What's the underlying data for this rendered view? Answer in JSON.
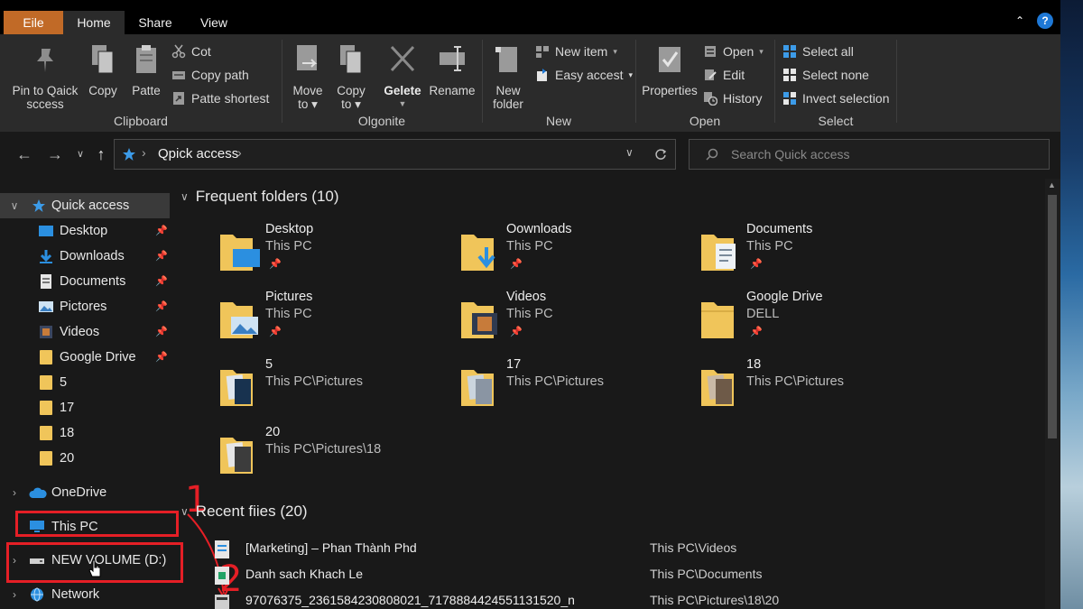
{
  "tabs": {
    "file": "Eile",
    "home": "Home",
    "share": "Share",
    "view": "View",
    "help": "?"
  },
  "ribbon": {
    "clipboard": {
      "pin": "Pin to Qaick\nsccess",
      "copy": "Copy",
      "paste": "Patte",
      "cut": "Cot",
      "copy_path": "Copy path",
      "paste_shortcut": "Patte shortest",
      "label": "Clipboard"
    },
    "organize": {
      "move_to": "Move\nto ▾",
      "copy_to": "Copy\nto ▾",
      "delete": "Gelete",
      "rename": "Rename",
      "label": "Olgonite"
    },
    "new": {
      "new_folder": "New\nfolder",
      "new_item": "New item",
      "easy_access": "Easy accest",
      "label": "New"
    },
    "open": {
      "properties": "Properties",
      "open": "Open",
      "edit": "Edit",
      "history": "History",
      "label": "Open"
    },
    "select": {
      "select_all": "Select all",
      "select_none": "Select none",
      "invert_selection": "Invect selection",
      "label": "Select"
    }
  },
  "address": {
    "path": "Qpick access",
    "search_placeholder": "Search Quick access"
  },
  "sidebar": {
    "quick_access": "Quick access",
    "pinned": [
      "Desktop",
      "Downloads",
      "Documents",
      "Pictores",
      "Videos",
      "Google Drive"
    ],
    "folders": [
      "5",
      "17",
      "18",
      "20"
    ],
    "onedrive": "OneDrive",
    "this_pc": "This PC",
    "new_volume": "NEW VOLUME (D:)",
    "network": "Network"
  },
  "annotations": {
    "step1": "1",
    "step2": "2"
  },
  "main": {
    "frequent_header": "Frequent folders (10)",
    "frequent": [
      {
        "name": "Desktop",
        "location": "This PC",
        "pinned": true
      },
      {
        "name": "Oownloads",
        "location": "This PC",
        "pinned": true
      },
      {
        "name": "Documents",
        "location": "This PC",
        "pinned": true
      },
      {
        "name": "Pictures",
        "location": "This PC",
        "pinned": true
      },
      {
        "name": "Videos",
        "location": "This PC",
        "pinned": true
      },
      {
        "name": "Google Drive",
        "location": "DELL",
        "pinned": true
      },
      {
        "name": "5",
        "location": "This PC\\Pictures",
        "pinned": false
      },
      {
        "name": "17",
        "location": "This PC\\Pictures",
        "pinned": false
      },
      {
        "name": "18",
        "location": "This PC\\Pictures",
        "pinned": false
      },
      {
        "name": "20",
        "location": "This PC\\Pictures\\18",
        "pinned": false
      }
    ],
    "recent_header": "Recent fiies (20)",
    "recent": [
      {
        "name": "[Marketing] – Phan Thành Phd",
        "path": "This PC\\Videos"
      },
      {
        "name": "Danh sach Khach Le",
        "path": "This PC\\Documents"
      },
      {
        "name": "97076375_2361584230808021_7178884424551131520_n",
        "path": "This PC\\Pictures\\18\\20"
      }
    ]
  }
}
